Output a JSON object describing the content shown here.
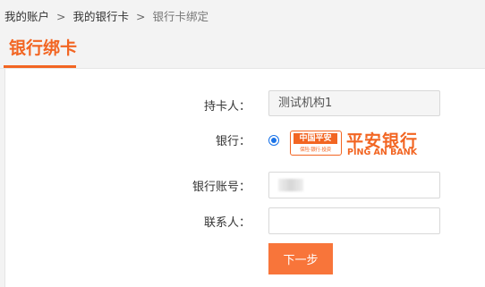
{
  "breadcrumb": {
    "items": [
      "我的账户",
      "我的银行卡"
    ],
    "separator": ">",
    "current": "银行卡绑定"
  },
  "tabs": {
    "active_label": "银行绑卡"
  },
  "form": {
    "cardholder": {
      "label": "持卡人：",
      "value": "测试机构1"
    },
    "bank": {
      "label": "银行：",
      "selected": true,
      "logo_badge": "中国平安",
      "logo_badge_sub": "保险·银行·投资",
      "logo_name_cn": "平安银行",
      "logo_name_en": "PING AN BANK"
    },
    "account": {
      "label": "银行账号：",
      "value": ""
    },
    "contact": {
      "label": "联系人：",
      "value": ""
    },
    "next_button": "下一步"
  },
  "colors": {
    "accent": "#f26522",
    "button": "#f8753a",
    "radio": "#1a73e8"
  }
}
